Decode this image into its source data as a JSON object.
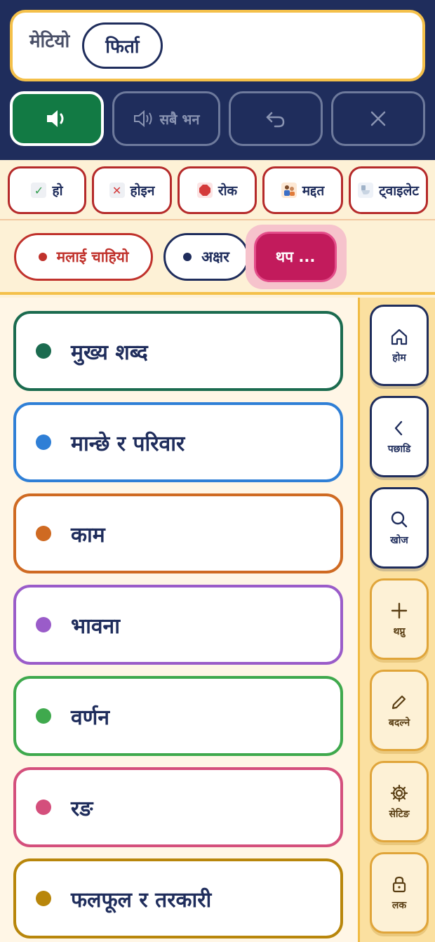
{
  "message": {
    "word": "मेटियो",
    "chip": "फिर्ता"
  },
  "controls": {
    "speak_icon": "speaker-icon",
    "speak_all_label": "सबै भन",
    "undo_icon": "undo-icon",
    "clear_icon": "close-icon"
  },
  "quick": [
    {
      "label": "हो",
      "icon": "check-icon"
    },
    {
      "label": "होइन",
      "icon": "cross-icon"
    },
    {
      "label": "रोक",
      "icon": "stop-sign-icon"
    },
    {
      "label": "मद्दत",
      "icon": "help-icon"
    },
    {
      "label": "ट्वाइलेट",
      "icon": "toilet-icon"
    }
  ],
  "modes": {
    "want": "मलाई चाहियो",
    "letters": "अक्षर",
    "more": "थप ..."
  },
  "categories": [
    {
      "label": "मुख्य शब्द",
      "color": "#1b6b4f"
    },
    {
      "label": "मान्छे र परिवार",
      "color": "#2f7fd6"
    },
    {
      "label": "काम",
      "color": "#cf6a22"
    },
    {
      "label": "भावना",
      "color": "#9a5cc9"
    },
    {
      "label": "वर्णन",
      "color": "#3fa94d"
    },
    {
      "label": "रङ",
      "color": "#d44f7c"
    },
    {
      "label": "फलफूल र तरकारी",
      "color": "#b8860b"
    }
  ],
  "rail": {
    "home": "होम",
    "back": "पछाडि",
    "search": "खोज",
    "add": "थप्नु",
    "edit": "बदल्ने",
    "settings": "सेटिङ",
    "lock": "लक"
  },
  "colors": {
    "navy": "#1f2d5c",
    "speak_green": "#127a44",
    "accent_yellow": "#f4c04a",
    "quick_red": "#b52a2a",
    "more_pink": "#c21b5c"
  }
}
